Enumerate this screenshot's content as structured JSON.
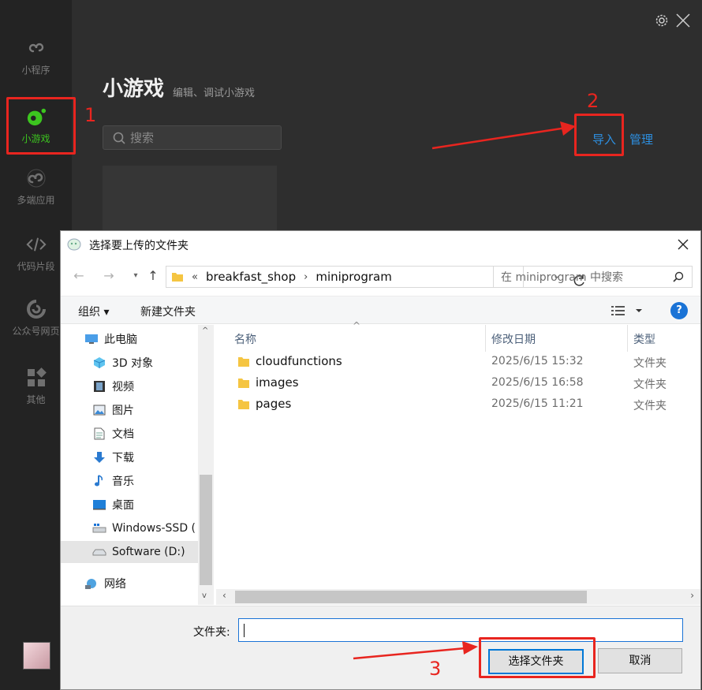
{
  "sidebar": {
    "items": [
      {
        "label": "小程序",
        "icon": "miniprogram-icon"
      },
      {
        "label": "小游戏",
        "icon": "minigame-icon"
      },
      {
        "label": "多端应用",
        "icon": "multiplatform-icon"
      },
      {
        "label": "代码片段",
        "icon": "code-snippet-icon"
      },
      {
        "label": "公众号网页",
        "icon": "official-account-icon"
      },
      {
        "label": "其他",
        "icon": "other-icon"
      }
    ],
    "active_color": "#3cc51f"
  },
  "header": {
    "title": "小游戏",
    "subtitle": "编辑、调试小游戏",
    "search_placeholder": "搜索",
    "import_label": "导入",
    "manage_label": "管理"
  },
  "annotations": {
    "step1": "1",
    "step2": "2",
    "step3": "3",
    "color": "#e8251f"
  },
  "dialog": {
    "title": "选择要上传的文件夹",
    "breadcrumb": {
      "prefix": "«",
      "parts": [
        "breakfast_shop",
        "miniprogram"
      ]
    },
    "search_placeholder": "在 miniprogram 中搜索",
    "toolbar": {
      "organize": "组织 ▾",
      "new_folder": "新建文件夹",
      "help": "?"
    },
    "nav": [
      {
        "label": "此电脑",
        "icon": "this-pc-icon"
      },
      {
        "label": "3D 对象",
        "icon": "3d-objects-icon"
      },
      {
        "label": "视频",
        "icon": "videos-icon"
      },
      {
        "label": "图片",
        "icon": "pictures-icon"
      },
      {
        "label": "文档",
        "icon": "documents-icon"
      },
      {
        "label": "下载",
        "icon": "downloads-icon"
      },
      {
        "label": "音乐",
        "icon": "music-icon"
      },
      {
        "label": "桌面",
        "icon": "desktop-icon"
      },
      {
        "label": "Windows-SSD (",
        "icon": "drive-c-icon"
      },
      {
        "label": "Software (D:)",
        "icon": "drive-d-icon"
      },
      {
        "label": "网络",
        "icon": "network-icon"
      }
    ],
    "columns": {
      "name": "名称",
      "date": "修改日期",
      "type": "类型"
    },
    "files": [
      {
        "name": "cloudfunctions",
        "date": "2025/6/15 15:32",
        "type": "文件夹"
      },
      {
        "name": "images",
        "date": "2025/6/15 16:58",
        "type": "文件夹"
      },
      {
        "name": "pages",
        "date": "2025/6/15 11:21",
        "type": "文件夹"
      }
    ],
    "folder_label": "文件夹:",
    "folder_value": "",
    "select_button": "选择文件夹",
    "cancel_button": "取消"
  }
}
